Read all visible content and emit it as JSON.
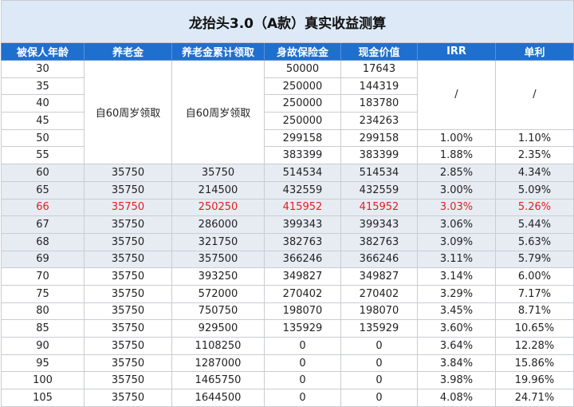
{
  "title": "龙抬头3.0（A款）真实收益测算",
  "headers": [
    "被保人年龄",
    "养老金",
    "养老金累计领取",
    "身故保险金",
    "现金价值",
    "IRR",
    "单利"
  ],
  "merged_text": "自60周岁领取",
  "merged_slash": "/",
  "rows": [
    {
      "age": "30",
      "pension": "",
      "cum": "",
      "death": "50000",
      "cash": "17643",
      "irr": "",
      "simple": ""
    },
    {
      "age": "35",
      "pension": "",
      "cum": "",
      "death": "250000",
      "cash": "144319",
      "irr": "",
      "simple": ""
    },
    {
      "age": "40",
      "pension": "",
      "cum": "",
      "death": "250000",
      "cash": "183780",
      "irr": "",
      "simple": ""
    },
    {
      "age": "45",
      "pension": "",
      "cum": "",
      "death": "250000",
      "cash": "234263",
      "irr": "",
      "simple": ""
    },
    {
      "age": "50",
      "pension": "",
      "cum": "",
      "death": "299158",
      "cash": "299158",
      "irr": "1.00%",
      "simple": "1.10%"
    },
    {
      "age": "55",
      "pension": "",
      "cum": "",
      "death": "383399",
      "cash": "383399",
      "irr": "1.88%",
      "simple": "2.35%"
    },
    {
      "age": "60",
      "pension": "35750",
      "cum": "35750",
      "death": "514534",
      "cash": "514534",
      "irr": "2.85%",
      "simple": "4.34%"
    },
    {
      "age": "65",
      "pension": "35750",
      "cum": "214500",
      "death": "432559",
      "cash": "432559",
      "irr": "3.00%",
      "simple": "5.09%"
    },
    {
      "age": "66",
      "pension": "35750",
      "cum": "250250",
      "death": "415952",
      "cash": "415952",
      "irr": "3.03%",
      "simple": "5.26%"
    },
    {
      "age": "67",
      "pension": "35750",
      "cum": "286000",
      "death": "399343",
      "cash": "399343",
      "irr": "3.06%",
      "simple": "5.44%"
    },
    {
      "age": "68",
      "pension": "35750",
      "cum": "321750",
      "death": "382763",
      "cash": "382763",
      "irr": "3.09%",
      "simple": "5.63%"
    },
    {
      "age": "69",
      "pension": "35750",
      "cum": "357500",
      "death": "366246",
      "cash": "366246",
      "irr": "3.11%",
      "simple": "5.79%"
    },
    {
      "age": "70",
      "pension": "35750",
      "cum": "393250",
      "death": "349827",
      "cash": "349827",
      "irr": "3.14%",
      "simple": "6.00%"
    },
    {
      "age": "75",
      "pension": "35750",
      "cum": "572000",
      "death": "270402",
      "cash": "270402",
      "irr": "3.29%",
      "simple": "7.17%"
    },
    {
      "age": "80",
      "pension": "35750",
      "cum": "750750",
      "death": "198070",
      "cash": "198070",
      "irr": "3.45%",
      "simple": "8.71%"
    },
    {
      "age": "85",
      "pension": "35750",
      "cum": "929500",
      "death": "135929",
      "cash": "135929",
      "irr": "3.60%",
      "simple": "10.65%"
    },
    {
      "age": "90",
      "pension": "35750",
      "cum": "1108250",
      "death": "0",
      "cash": "0",
      "irr": "3.64%",
      "simple": "12.28%"
    },
    {
      "age": "95",
      "pension": "35750",
      "cum": "1287000",
      "death": "0",
      "cash": "0",
      "irr": "3.84%",
      "simple": "15.86%"
    },
    {
      "age": "100",
      "pension": "35750",
      "cum": "1465750",
      "death": "0",
      "cash": "0",
      "irr": "3.98%",
      "simple": "19.96%"
    },
    {
      "age": "105",
      "pension": "35750",
      "cum": "1644500",
      "death": "0",
      "cash": "0",
      "irr": "4.08%",
      "simple": "24.71%"
    }
  ],
  "highlight_rows": [
    6,
    7,
    8,
    9,
    10,
    11
  ],
  "red_row": 8,
  "colors": {
    "header_bg": "#1f6fcf",
    "title_bg": "#dde9f7",
    "highlight_bg": "#e7ecf3",
    "red_text": "#e02020"
  }
}
